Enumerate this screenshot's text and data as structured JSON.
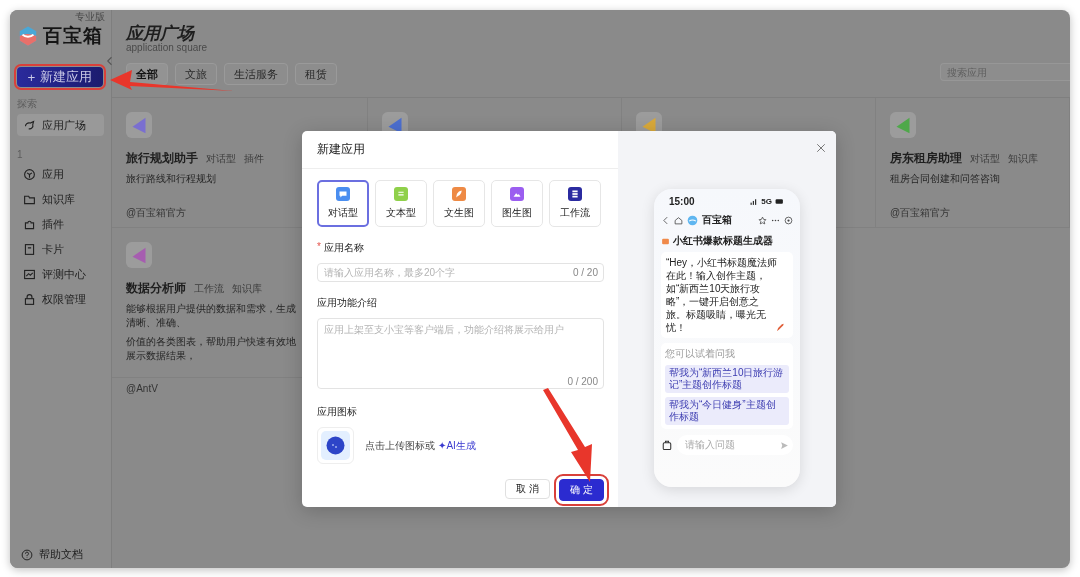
{
  "sidebar": {
    "logo": "百宝箱",
    "edition": "专业版",
    "new_button": {
      "icon": "+",
      "label": "新建应用"
    },
    "groups": [
      {
        "label": "探索",
        "items": [
          {
            "label": "应用广场",
            "selected": true
          }
        ]
      },
      {
        "label": "1",
        "items": [
          {
            "label": "应用",
            "selected": false
          },
          {
            "label": "知识库",
            "selected": false
          },
          {
            "label": "插件",
            "selected": false
          },
          {
            "label": "卡片",
            "selected": false
          },
          {
            "label": "评测中心",
            "selected": false
          },
          {
            "label": "权限管理",
            "selected": false
          }
        ]
      }
    ],
    "help": "帮助文档"
  },
  "header": {
    "title": "应用广场",
    "subtitle": "application square",
    "tabs": [
      {
        "label": "全部",
        "selected": true
      },
      {
        "label": "文旅",
        "selected": false
      },
      {
        "label": "生活服务",
        "selected": false
      },
      {
        "label": "租赁",
        "selected": false
      }
    ],
    "search": {
      "placeholder": "搜索应用"
    }
  },
  "cards": [
    {
      "name": "旅行规划助手",
      "tags": [
        "对话型",
        "插件"
      ],
      "description": [
        "旅行路线和行程规划"
      ],
      "author": "@百宝箱官方",
      "color": "#7a6fd0"
    },
    {
      "color": "#4c6fd0"
    },
    {
      "color": "#d9a93a"
    },
    {
      "name": "房东租房助理",
      "tags": [
        "对话型",
        "知识库"
      ],
      "description": [
        "租房合同创建和问答咨询"
      ],
      "author": "@百宝箱官方",
      "color": "#4fa84a"
    },
    {
      "name": "数据分析师",
      "tags": [
        "工作流",
        "知识库"
      ],
      "description": [
        "能够根据用户提供的数据和需求，生成清晰、准确、",
        "价值的各类图表，帮助用户快速有效地展示数据结果，"
      ],
      "author": "@AntV",
      "color": "#a65db0"
    }
  ],
  "dialog": {
    "title": "新建应用",
    "types": [
      {
        "label": "对话型",
        "selected": true
      },
      {
        "label": "文本型",
        "selected": false
      },
      {
        "label": "文生图",
        "selected": false
      },
      {
        "label": "图生图",
        "selected": false
      },
      {
        "label": "工作流",
        "selected": false
      }
    ],
    "name_field": {
      "required_mark": "*",
      "label": "应用名称",
      "placeholder": "请输入应用名称，最多20个字",
      "counter": "0 / 20"
    },
    "description_field": {
      "label": "应用功能介绍",
      "placeholder": "应用上架至支小宝等客户端后，功能介绍将展示给用户",
      "counter": "0 / 200"
    },
    "icon_field": {
      "label": "应用图标",
      "hint": "点击上传图标或",
      "ai_link": "✦AI生成"
    },
    "buttons": [
      {
        "label": "取 消",
        "kind": "secondary"
      },
      {
        "label": "确 定",
        "kind": "primary"
      }
    ],
    "preview": {
      "time": "15:00",
      "network": "5G",
      "app_name": "百宝箱",
      "bot_name": "小红书爆款标题生成器",
      "greeting": "“Hey，小红书标题魔法师在此！输入创作主题，如“新西兰10天旅行攻略”，一键开启创意之旅。标题吸睛，曝光无忧！",
      "suggestions_label": "您可以试着问我",
      "suggestions": [
        "帮我为“新西兰10日旅行游记”主题创作标题",
        "帮我为“今日健身”主题创作标题"
      ],
      "input_placeholder": "请输入问题"
    }
  }
}
